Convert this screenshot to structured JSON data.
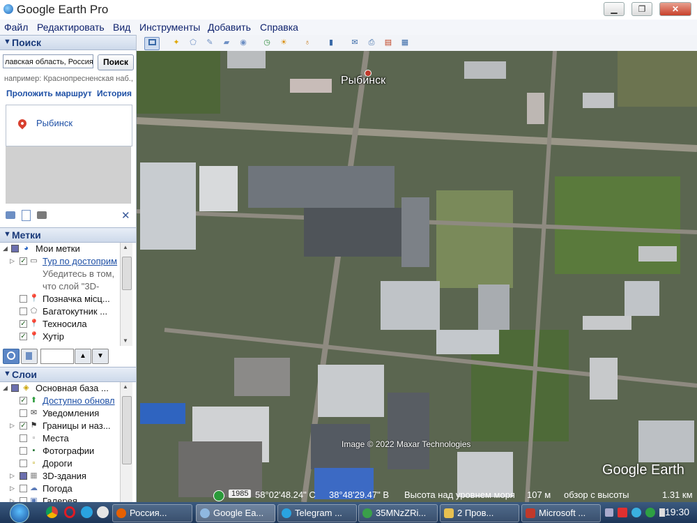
{
  "window": {
    "title": "Google Earth Pro",
    "minimize": "▁",
    "maximize": "❐",
    "close": "✕"
  },
  "menu": [
    "Файл",
    "Редактировать",
    "Вид",
    "Инструменты",
    "Добавить",
    "Справка"
  ],
  "search": {
    "header": "Поиск",
    "query": "лавская область, Россия",
    "button": "Поиск",
    "hint": "например: Краснопресненская наб.,",
    "route_link": "Проложить маршрут",
    "history_link": "История",
    "result": "Рыбинск"
  },
  "places": {
    "header": "Метки",
    "items": [
      {
        "label": "Мои метки",
        "style": "normal",
        "check": "partial"
      },
      {
        "label": "Тур по достоприм",
        "style": "link",
        "check": "checked"
      },
      {
        "label": "Убедитесь в том,",
        "style": "grey",
        "check": "none"
      },
      {
        "label": "что слой \"3D-",
        "style": "grey",
        "check": "none"
      },
      {
        "label": "Позначка місц...",
        "style": "normal",
        "check": "empty"
      },
      {
        "label": "Багатокутник ...",
        "style": "normal",
        "check": "empty"
      },
      {
        "label": "Техносила",
        "style": "normal",
        "check": "checked"
      },
      {
        "label": "Хутір",
        "style": "normal",
        "check": "checked"
      }
    ]
  },
  "layers": {
    "header": "Слои",
    "items": [
      {
        "label": "Основная база ...",
        "style": "normal",
        "check": "partial"
      },
      {
        "label": "Доступно обновл",
        "style": "link",
        "check": "checked"
      },
      {
        "label": "Уведомления",
        "style": "normal",
        "check": "empty"
      },
      {
        "label": "Границы и наз...",
        "style": "normal",
        "check": "checked"
      },
      {
        "label": "Места",
        "style": "normal",
        "check": "empty"
      },
      {
        "label": "Фотографии",
        "style": "normal",
        "check": "empty"
      },
      {
        "label": "Дороги",
        "style": "normal",
        "check": "empty"
      },
      {
        "label": "3D-здания",
        "style": "normal",
        "check": "partial"
      },
      {
        "label": "Погода",
        "style": "normal",
        "check": "empty"
      },
      {
        "label": "Галерея",
        "style": "normal",
        "check": "empty"
      }
    ]
  },
  "map": {
    "city_label": "Рыбинск",
    "copyright": "Image © 2022 Maxar Technologies",
    "logo": "Google Earth"
  },
  "status": {
    "year": "1985",
    "lat": "58°02'48.24\" С",
    "lon": "38°48'29.47\" В",
    "elev_label": "Высота над уровнем моря",
    "elev": "107 м",
    "eye_label": "обзор с высоты",
    "eye": "1.31 км"
  },
  "taskbar": {
    "tasks": [
      "Россия...",
      "Google Ea...",
      "Telegram ...",
      "35MNzZRi...",
      "2 Пров...",
      "Microsoft ..."
    ],
    "clock": "19:30"
  }
}
